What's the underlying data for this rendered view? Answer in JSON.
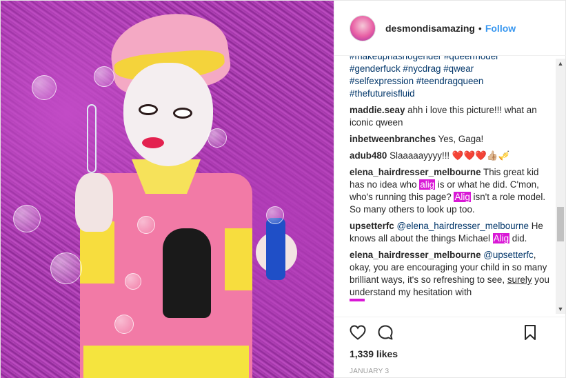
{
  "header": {
    "username": "desmondisamazing",
    "separator": "•",
    "follow_label": "Follow"
  },
  "hashtags": [
    "#makeuphasnogender #queermodel",
    "#genderfuck #nycdrag #qwear",
    "#selfexpression #teendragqueen",
    "#thefutureisfluid"
  ],
  "comments": [
    {
      "user": "maddie.seay",
      "text": "ahh i love this picture!!! what an iconic qween"
    },
    {
      "user": "inbetweenbranches",
      "text": "Yes, Gaga!"
    },
    {
      "user": "adub480",
      "text": "Slaaaaayyyy!!! ❤️❤️❤️👍🏼🎺"
    },
    {
      "user": "elena_hairdresser_melbourne",
      "text_a": "This great kid has no idea who",
      "hl_a": "alig",
      "text_b": "is or what he did. C'mon, who's running this page?",
      "hl_b": "Alig",
      "text_c": "isn't a role model. So many others to look up too."
    },
    {
      "user": "upsetterfc",
      "mention": "@elena_hairdresser_melbourne",
      "text_a": "He knows all about the things Michael",
      "hl": "Alig",
      "text_b": "did."
    },
    {
      "user": "elena_hairdresser_melbourne",
      "mention": "@upsetterfc",
      "text_a": ", okay, you are encouraging your child in so many brilliant ways, it's so refreshing to see,",
      "underline": "surely",
      "text_b": "you understand my hesitation with"
    }
  ],
  "likes": "1,339 likes",
  "date": "JANUARY 3",
  "colors": {
    "follow": "#3897f0",
    "highlight": "#d918d6",
    "hashtag": "#003569"
  },
  "icons": [
    "heart-icon",
    "comment-icon",
    "bookmark-icon"
  ]
}
